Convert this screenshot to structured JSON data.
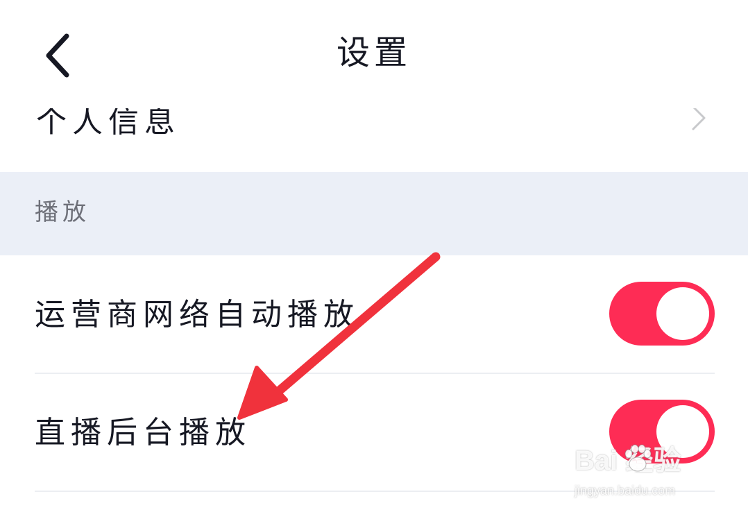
{
  "header": {
    "title": "设置",
    "back_icon": "chevron-left-icon"
  },
  "partial_row": {
    "label": "个人信息",
    "chevron_icon": "chevron-right-icon"
  },
  "section": {
    "label": "播放"
  },
  "rows": [
    {
      "label": "运营商网络自动播放",
      "toggle_on": true
    },
    {
      "label": "直播后台播放",
      "toggle_on": true
    }
  ],
  "colors": {
    "toggle_on": "#fe2c55",
    "section_band": "#ebeff7",
    "annotation_arrow": "#f0323c"
  },
  "watermark": {
    "brand": "Bai  经验",
    "url": "jingyan.baidu.com"
  }
}
